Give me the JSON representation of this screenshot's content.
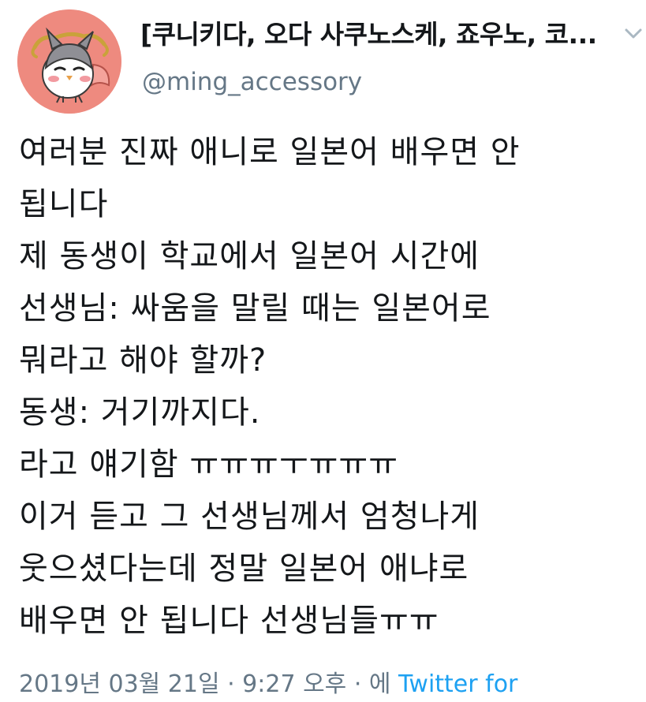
{
  "tweet": {
    "display_name": "[쿠니키다, 오다 사쿠노스케, 죠우노, 코...",
    "handle": "@ming_accessory",
    "lines": [
      "여러분 진짜 애니로 일본어 배우면 안",
      "됩니다",
      "제 동생이 학교에서 일본어 시간에",
      "선생님: 싸움을 말릴 때는 일본어로",
      "뭐라고 해야 할까?",
      "동생: 거기까지다.",
      "라고 얘기함 ㅠㅠㅠㅜㅠㅠㅠ",
      "이거 듣고 그 선생님께서 엄청나게",
      "웃으셨다는데 정말 일본어 애냐로",
      "배우면 안 됩니다 선생님들ㅠㅠ"
    ],
    "timestamp": "2019년 03월 21일 · 9:27 오후 · 에",
    "source": "Twitter for"
  },
  "icons": {
    "menu": "chevron-down-icon",
    "avatar": "cartoon-bird-avatar"
  },
  "colors": {
    "text": "#14171a",
    "secondary": "#657786",
    "link": "#1da1f2",
    "avatar_bg": "#ee8a7f"
  }
}
